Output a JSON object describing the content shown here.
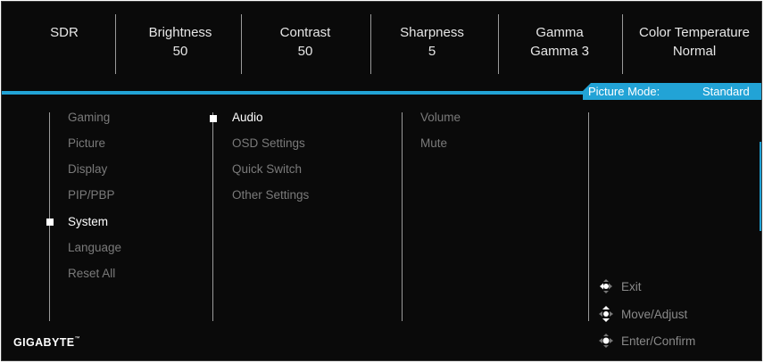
{
  "header": [
    {
      "label": "SDR",
      "value": ""
    },
    {
      "label": "Brightness",
      "value": "50"
    },
    {
      "label": "Contrast",
      "value": "50"
    },
    {
      "label": "Sharpness",
      "value": "5"
    },
    {
      "label": "Gamma",
      "value": "Gamma 3"
    },
    {
      "label": "Color Temperature",
      "value": "Normal"
    }
  ],
  "picture_mode": {
    "label": "Picture Mode:",
    "value": "Standard"
  },
  "menu": {
    "main": [
      "Gaming",
      "Picture",
      "Display",
      "PIP/PBP",
      "System",
      "Language",
      "Reset All"
    ],
    "main_selected": "System",
    "sub": [
      "Audio",
      "OSD Settings",
      "Quick Switch",
      "Other Settings"
    ],
    "sub_selected": "Audio",
    "options": [
      "Volume",
      "Mute"
    ]
  },
  "nav": {
    "exit": "Exit",
    "move": "Move/Adjust",
    "enter": "Enter/Confirm",
    "icon": "joystick-icon"
  },
  "brand": {
    "logo": "GIGABYTE",
    "tm": "™"
  },
  "colors": {
    "accent": "#22a3d6",
    "background": "#0a0a0a",
    "inactive_text": "#7a7a7a",
    "active_text": "#ffffff"
  }
}
